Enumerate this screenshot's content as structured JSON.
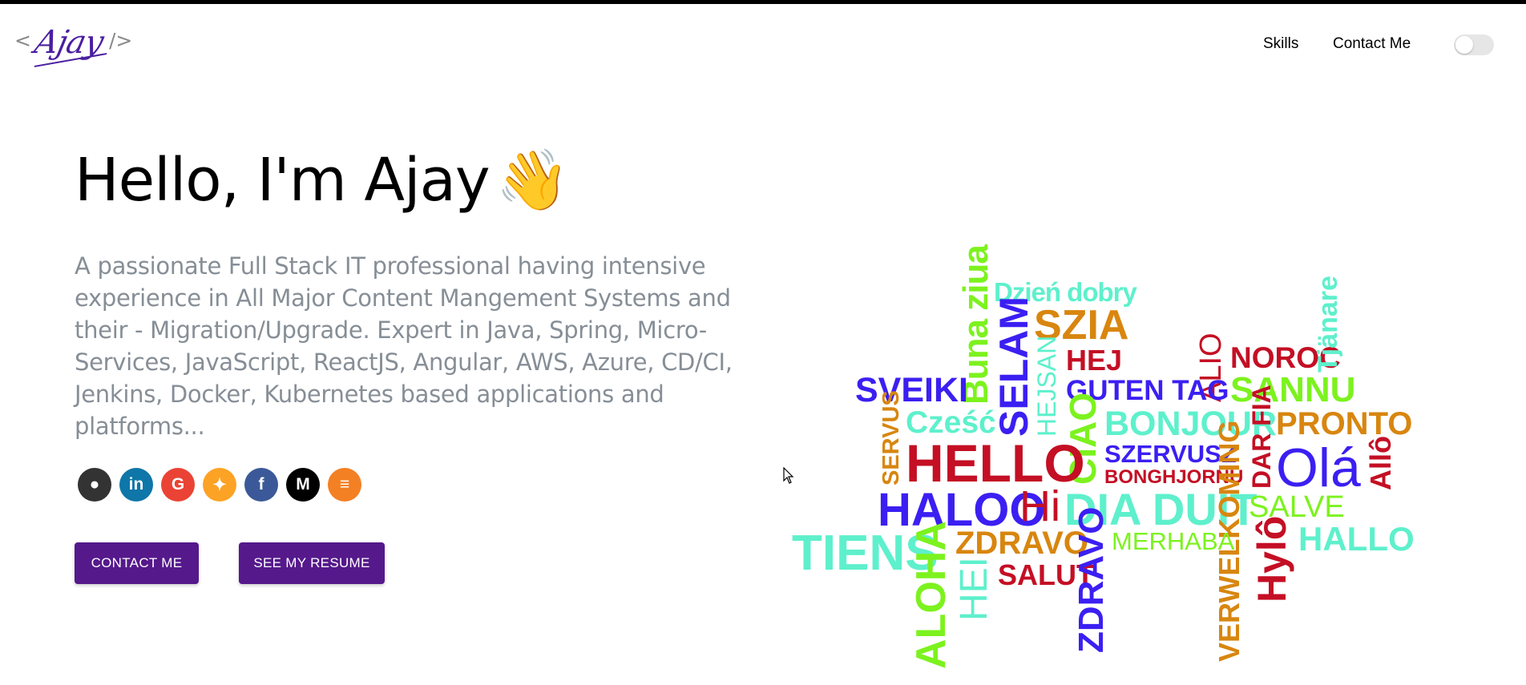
{
  "header": {
    "logo": {
      "open": "<",
      "signature": "Ajay",
      "close": "/>"
    },
    "nav": [
      {
        "label": "Skills"
      },
      {
        "label": "Contact Me"
      }
    ],
    "theme_toggle": {
      "state": "off"
    }
  },
  "hero": {
    "greeting": "Hello, I'm Ajay",
    "wave": "👋",
    "intro": "A passionate Full Stack IT professional having intensive experience in All Major Content Mangement Systems and their - Migration/Upgrade. Expert in Java, Spring, Micro-Services, JavaScript, ReactJS, Angular, AWS, Azure, CD/CI, Jenkins, Docker, Kubernetes based applications and platforms...",
    "socials": [
      {
        "name": "github",
        "glyph": "●",
        "color": "#333333"
      },
      {
        "name": "linkedin",
        "glyph": "in",
        "color": "#0e76a8"
      },
      {
        "name": "google",
        "glyph": "G",
        "color": "#ea4335"
      },
      {
        "name": "gitlab",
        "glyph": "✦",
        "color": "#fca326"
      },
      {
        "name": "facebook",
        "glyph": "f",
        "color": "#3b5998"
      },
      {
        "name": "medium",
        "glyph": "M",
        "color": "#000000"
      },
      {
        "name": "stack-overflow",
        "glyph": "≡",
        "color": "#f48024"
      }
    ],
    "buttons": {
      "contact": "CONTACT ME",
      "resume": "SEE MY RESUME"
    }
  },
  "colors": {
    "accent": "#55198b",
    "blue": "#3b1ff2",
    "lime": "#7cf21e",
    "teal": "#5ef0cc",
    "orange": "#d8860f",
    "red": "#c40f24"
  },
  "word_cloud": [
    "Buna ziua",
    "Dzień dobry",
    "SZIA",
    "SELAM",
    "HEJSAN",
    "HEJ",
    "ALIO",
    "NOROC",
    "Tjänare",
    "SVEIKI",
    "GUTEN TAG",
    "SANNU",
    "SERVUS",
    "Cześć",
    "BONJOUR",
    "PRONTO",
    "CIAO",
    "HELLO",
    "SZERVUSZ",
    "BONGHJORNU",
    "DAR FIA",
    "Olá",
    "Allô",
    "HALOO",
    "Hi",
    "DIA DUIT",
    "VERWELKOMING",
    "SALVE",
    "TIENS",
    "ALOHA",
    "ZDRAVO",
    "MERHABA",
    "HALLO",
    "HEI",
    "SALUT",
    "ZDRAVO",
    "Hylô"
  ]
}
